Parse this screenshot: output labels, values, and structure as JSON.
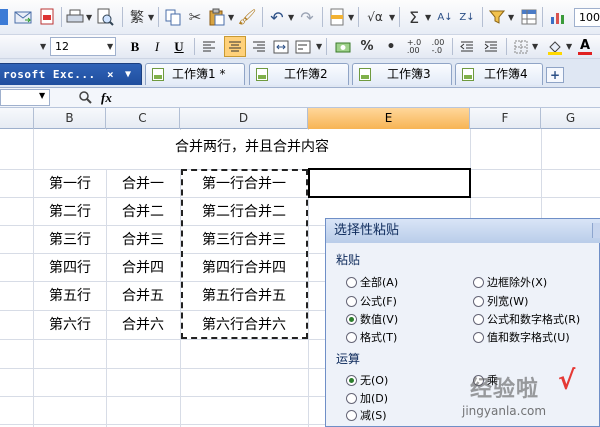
{
  "toolbar": {
    "zoom": "100",
    "font_size": "12"
  },
  "tabs": [
    {
      "label": "rosoft Exc...",
      "close": "×"
    },
    {
      "label": "工作簿1 *"
    },
    {
      "label": "工作簿2"
    },
    {
      "label": "工作簿3"
    },
    {
      "label": "工作簿4"
    }
  ],
  "formula_bar": {
    "fx": "fx"
  },
  "columns": [
    "B",
    "C",
    "D",
    "E",
    "F",
    "G"
  ],
  "sheet": {
    "title": "合并两行，并且合并内容",
    "rows": [
      [
        "第一行",
        "合并一",
        "第一行合并一"
      ],
      [
        "第二行",
        "合并二",
        "第二行合并二"
      ],
      [
        "第三行",
        "合并三",
        "第三行合并三"
      ],
      [
        "第四行",
        "合并四",
        "第四行合并四"
      ],
      [
        "第五行",
        "合并五",
        "第五行合并五"
      ],
      [
        "第六行",
        "合并六",
        "第六行合并六"
      ]
    ]
  },
  "dialog": {
    "title": "选择性粘贴",
    "paste_group": "粘贴",
    "paste_options_left": [
      {
        "label": "全部(A)",
        "selected": false
      },
      {
        "label": "公式(F)",
        "selected": false
      },
      {
        "label": "数值(V)",
        "selected": true
      },
      {
        "label": "格式(T)",
        "selected": false
      }
    ],
    "paste_options_right": [
      {
        "label": "边框除外(X)",
        "selected": false
      },
      {
        "label": "列宽(W)",
        "selected": false
      },
      {
        "label": "公式和数字格式(R)",
        "selected": false
      },
      {
        "label": "值和数字格式(U)",
        "selected": false
      }
    ],
    "operation_group": "运算",
    "operation_options": [
      {
        "label": "无(O)",
        "selected": true
      },
      {
        "label": "加(D)",
        "selected": false
      },
      {
        "label": "减(S)",
        "selected": false
      }
    ],
    "operation_options_right": [
      {
        "label": "乘",
        "selected": false
      }
    ]
  },
  "watermark": {
    "brand": "经验啦",
    "check": "√",
    "url": "jingyanla.com"
  }
}
